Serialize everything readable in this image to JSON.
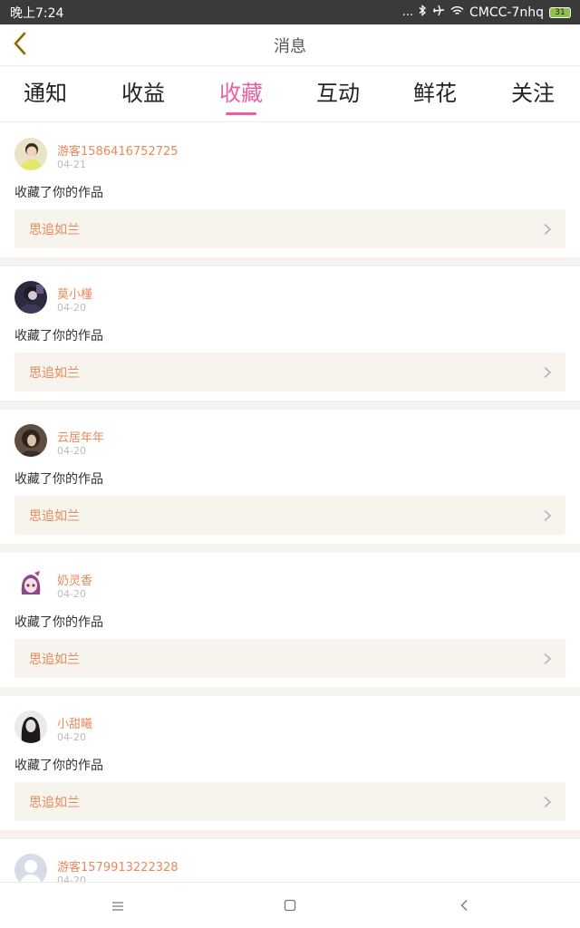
{
  "status_bar": {
    "time": "晚上7:24",
    "dots": "...",
    "carrier": "CMCC-7nhq",
    "battery": "31"
  },
  "header": {
    "title": "消息"
  },
  "tabs": [
    {
      "label": "通知",
      "active": false
    },
    {
      "label": "收益",
      "active": false
    },
    {
      "label": "收藏",
      "active": true
    },
    {
      "label": "互动",
      "active": false
    },
    {
      "label": "鲜花",
      "active": false
    },
    {
      "label": "关注",
      "active": false
    }
  ],
  "colors": {
    "accent_pink": "#ea5fa0",
    "name_orange": "#e8895a",
    "box_bg": "#f6f4ec",
    "divider_bg": "#f6f3ef"
  },
  "messages": [
    {
      "user": "游客1586416752725",
      "date": "04-21",
      "action": "收藏了你的作品",
      "work": "思追如兰"
    },
    {
      "user": "莫小槿",
      "date": "04-20",
      "action": "收藏了你的作品",
      "work": "思追如兰"
    },
    {
      "user": "云居年年",
      "date": "04-20",
      "action": "收藏了你的作品",
      "work": "思追如兰"
    },
    {
      "user": "奶灵香",
      "date": "04-20",
      "action": "收藏了你的作品",
      "work": "思追如兰"
    },
    {
      "user": "小甜曦",
      "date": "04-20",
      "action": "收藏了你的作品",
      "work": "思追如兰"
    },
    {
      "user": "游客1579913222328",
      "date": "04-20",
      "action": "",
      "work": ""
    }
  ],
  "icons": {
    "back": "chevron-left-icon",
    "work_arrow": "chevron-right-icon",
    "nav_menu": "menu-icon",
    "nav_home": "square-home-icon",
    "nav_back": "triangle-back-icon"
  }
}
